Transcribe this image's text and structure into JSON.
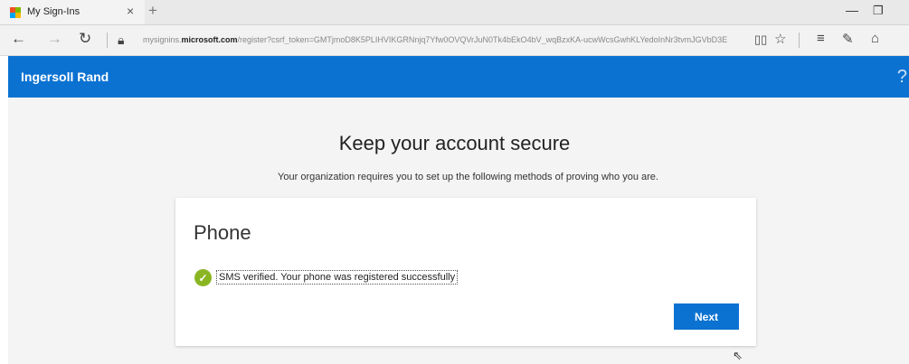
{
  "browser": {
    "tab_title": "My Sign-Ins",
    "tab_close": "×",
    "new_tab": "+",
    "url_prefix": "mysignins.",
    "url_domain": "microsoft.com",
    "url_rest": "/register?csrf_token=GMTjmoD8K5PLIHVIKGRNnjq7Yfw0OVQVrJuN0Tk4bEkO4bV_wqBzxKA-ucwWcsGwhKLYedoInNr3tvmJGVbD3E",
    "icons": {
      "back": "arrow-left-icon",
      "forward": "arrow-right-icon",
      "refresh": "refresh-icon",
      "lock": "lock-icon",
      "reading_view": "book-icon",
      "favorite": "star-icon",
      "hub": "hub-icon",
      "notes": "pen-icon",
      "share": "share-icon"
    }
  },
  "brand": {
    "title": "Ingersoll Rand",
    "help": "?",
    "color": "#0b72d2"
  },
  "page": {
    "heading": "Keep your account secure",
    "subtext": "Your organization requires you to set up the following methods of proving who you are."
  },
  "card": {
    "title": "Phone",
    "message": "SMS verified. Your phone was registered successfully",
    "next_label": "Next",
    "success_color": "#8ab523"
  }
}
